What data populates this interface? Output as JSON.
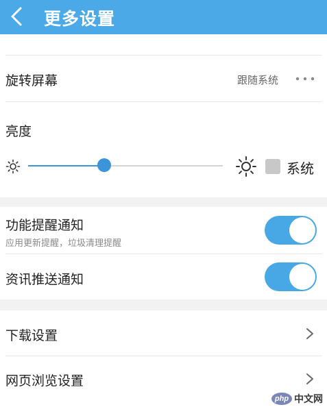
{
  "header": {
    "title": "更多设置",
    "back_icon": "chevron-left-icon"
  },
  "rotate": {
    "label": "旋转屏幕",
    "value": "跟随系统",
    "more_icon": "more-dots-icon"
  },
  "brightness": {
    "label": "亮度",
    "level": 0.39,
    "low_icon": "sun-small-icon",
    "high_icon": "sun-large-icon",
    "system_checked": false,
    "system_label": "系统"
  },
  "notifications": {
    "feature": {
      "label": "功能提醒通知",
      "sub": "应用更新提醒，垃圾清理提醒",
      "enabled": true
    },
    "news": {
      "label": "资讯推送通知",
      "enabled": true
    }
  },
  "links": {
    "download": {
      "label": "下载设置",
      "icon": "chevron-right-icon"
    },
    "browser": {
      "label": "网页浏览设置",
      "icon": "chevron-right-icon"
    }
  },
  "watermark": {
    "logo": "php",
    "site": "中文网"
  },
  "colors": {
    "accent": "#4aa9e6",
    "toggle_on": "#48a8e6",
    "slider": "#3b95d8"
  }
}
